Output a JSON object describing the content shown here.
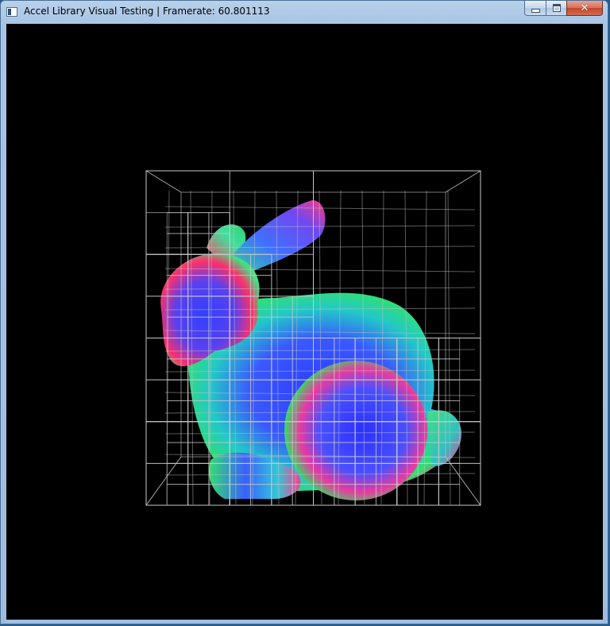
{
  "window": {
    "title": "Accel Library Visual Testing | Framerate: 60.801113",
    "icon": "application-window-icon"
  },
  "caption_buttons": {
    "minimize_icon": "minimize-icon",
    "maximize_icon": "maximize-icon",
    "close_label": "✕"
  },
  "scene": {
    "background": "#000000",
    "wireframe_color": "#c8c8c8",
    "model": "stanford-bunny",
    "shading": "normal-mapped (red/green/blue)"
  }
}
